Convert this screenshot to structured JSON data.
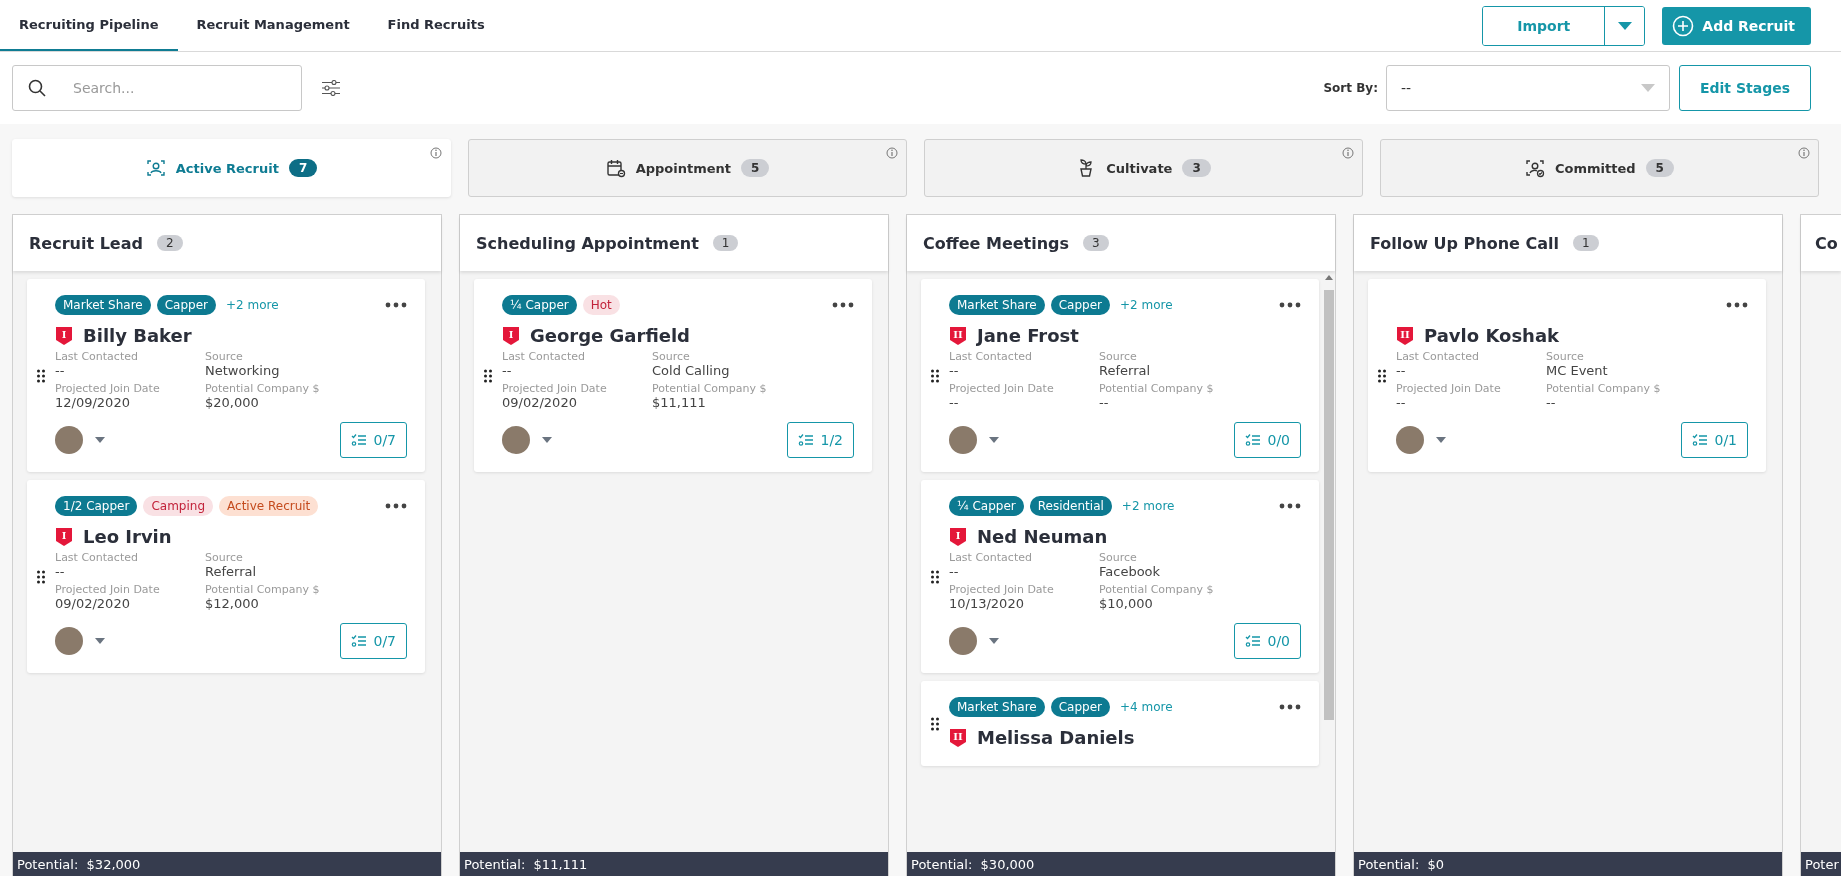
{
  "nav": {
    "tabs": [
      {
        "label": "Recruiting Pipeline",
        "selected": true
      },
      {
        "label": "Recruit Management",
        "selected": false
      },
      {
        "label": "Find Recruits",
        "selected": false
      }
    ],
    "import_button": "Import",
    "add_button": "Add Recruit"
  },
  "toolbar": {
    "search": {
      "placeholder": "Search..."
    },
    "sort_label": "Sort By:",
    "sort_value": "--",
    "edit_button": "Edit Stages"
  },
  "stages": [
    {
      "label": "Active Recruit",
      "count": "7",
      "selected": true
    },
    {
      "label": "Appointment",
      "count": "5",
      "selected": false
    },
    {
      "label": "Cultivate",
      "count": "3",
      "selected": false
    },
    {
      "label": "Committed",
      "count": "5",
      "selected": false
    }
  ],
  "columns": [
    {
      "title": "Recruit Lead",
      "count": "2",
      "footer": "Potential:  $32,000",
      "scrollbar": false,
      "cards": [
        {
          "tags": [
            {
              "text": "Market Share",
              "kind": "primary"
            },
            {
              "text": "Capper",
              "kind": "primary"
            }
          ],
          "more": "+2 more",
          "rank": "I",
          "name": "Billy Baker",
          "fields": [
            {
              "label": "Last Contacted",
              "value": "--"
            },
            {
              "label": "Source",
              "value": "Networking"
            },
            {
              "label": "Projected Join Date",
              "value": "12/09/2020"
            },
            {
              "label": "Potential Company $",
              "value": "$20,000"
            }
          ],
          "tasks": "0/7"
        },
        {
          "tags": [
            {
              "text": "1/2 Capper",
              "kind": "primary"
            },
            {
              "text": "Camping",
              "kind": "pink"
            },
            {
              "text": "Active Recruit",
              "kind": "peach"
            }
          ],
          "rank": "I",
          "name": "Leo Irvin",
          "fields": [
            {
              "label": "Last Contacted",
              "value": "--"
            },
            {
              "label": "Source",
              "value": "Referral"
            },
            {
              "label": "Projected Join Date",
              "value": "09/02/2020"
            },
            {
              "label": "Potential Company $",
              "value": "$12,000"
            }
          ],
          "tasks": "0/7"
        }
      ]
    },
    {
      "title": "Scheduling Appointment",
      "count": "1",
      "footer": "Potential:  $11,111",
      "scrollbar": false,
      "cards": [
        {
          "tags": [
            {
              "text": "¼ Capper",
              "kind": "primary"
            },
            {
              "text": "Hot",
              "kind": "pink"
            }
          ],
          "rank": "I",
          "name": "George Garfield",
          "fields": [
            {
              "label": "Last Contacted",
              "value": "--"
            },
            {
              "label": "Source",
              "value": "Cold Calling"
            },
            {
              "label": "Projected Join Date",
              "value": "09/02/2020"
            },
            {
              "label": "Potential Company $",
              "value": "$11,111"
            }
          ],
          "tasks": "1/2"
        }
      ]
    },
    {
      "title": "Coffee Meetings",
      "count": "3",
      "footer": "Potential:  $30,000",
      "scrollbar": true,
      "cards": [
        {
          "tags": [
            {
              "text": "Market Share",
              "kind": "primary"
            },
            {
              "text": "Capper",
              "kind": "primary"
            }
          ],
          "more": "+2 more",
          "rank": "II",
          "name": "Jane Frost",
          "fields": [
            {
              "label": "Last Contacted",
              "value": "--"
            },
            {
              "label": "Source",
              "value": "Referral"
            },
            {
              "label": "Projected Join Date",
              "value": "--"
            },
            {
              "label": "Potential Company $",
              "value": "--"
            }
          ],
          "tasks": "0/0"
        },
        {
          "tags": [
            {
              "text": "¼ Capper",
              "kind": "primary"
            },
            {
              "text": "Residential",
              "kind": "primary"
            }
          ],
          "more": "+2 more",
          "rank": "I",
          "name": "Ned Neuman",
          "fields": [
            {
              "label": "Last Contacted",
              "value": "--"
            },
            {
              "label": "Source",
              "value": "Facebook"
            },
            {
              "label": "Projected Join Date",
              "value": "10/13/2020"
            },
            {
              "label": "Potential Company $",
              "value": "$10,000"
            }
          ],
          "tasks": "0/0"
        },
        {
          "tags": [
            {
              "text": "Market Share",
              "kind": "primary"
            },
            {
              "text": "Capper",
              "kind": "primary"
            }
          ],
          "more": "+4 more",
          "rank": "II",
          "name": "Melissa Daniels"
        }
      ]
    },
    {
      "title": "Follow Up Phone Call",
      "count": "1",
      "footer": "Potential:  $0",
      "scrollbar": false,
      "cards": [
        {
          "rank": "II",
          "name": "Pavlo Koshak",
          "fields": [
            {
              "label": "Last Contacted",
              "value": "--"
            },
            {
              "label": "Source",
              "value": "MC Event"
            },
            {
              "label": "Projected Join Date",
              "value": "--"
            },
            {
              "label": "Potential Company $",
              "value": "--"
            }
          ],
          "tasks": "0/1"
        }
      ]
    },
    {
      "title": "Co",
      "footer": "Poter",
      "scrollbar": false
    }
  ]
}
